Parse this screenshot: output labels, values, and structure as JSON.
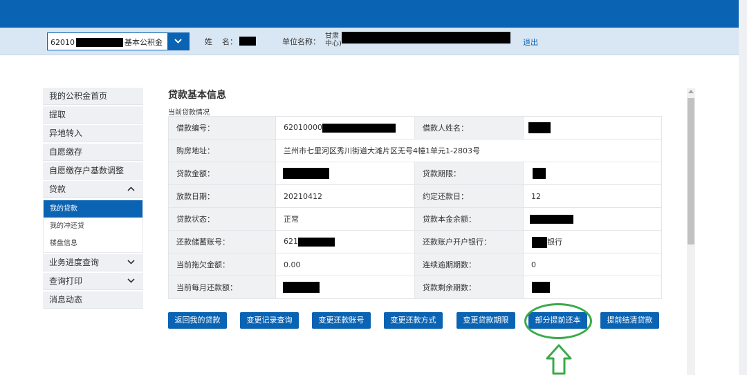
{
  "header": {
    "account_prefix": "62010",
    "account_type": "基本公积金",
    "name_label": "姓    名：",
    "unit_label": "单位名称：",
    "unit_visible": "甘肃 中心)",
    "logout": "退出"
  },
  "sidebar": {
    "items": [
      {
        "label": "我的公积金首页"
      },
      {
        "label": "提取"
      },
      {
        "label": "异地转入"
      },
      {
        "label": "自愿缴存"
      },
      {
        "label": "自愿缴存户基数调整"
      },
      {
        "label": "贷款",
        "expanded": true
      },
      {
        "label": "业务进度查询"
      },
      {
        "label": "查询打印"
      },
      {
        "label": "消息动态"
      }
    ],
    "sub_items": [
      {
        "label": "我的贷款",
        "active": true
      },
      {
        "label": "我的冲还贷"
      },
      {
        "label": "楼盘信息"
      }
    ]
  },
  "main": {
    "title": "贷款基本信息",
    "subtitle": "当前贷款情况",
    "rows": [
      {
        "k1": "借款编号：",
        "v1": "62010000",
        "k2": "借款人姓名：",
        "v2": ""
      },
      {
        "k1": "购房地址：",
        "v1": "兰州市七里河区秀川街道大滩片区无号4幢1单元1-2803号"
      },
      {
        "k1": "贷款金额：",
        "v1": "",
        "k2": "贷款期限：",
        "v2": ""
      },
      {
        "k1": "放款日期：",
        "v1": "20210412",
        "k2": "约定还款日：",
        "v2": "12"
      },
      {
        "k1": "贷款状态：",
        "v1": "正常",
        "k2": "贷款本金余额：",
        "v2": ""
      },
      {
        "k1": "还款储蓄账号：",
        "v1": "621",
        "k2": "还款账户开户银行：",
        "v2": "银行"
      },
      {
        "k1": "当前拖欠金额：",
        "v1": "0.00",
        "k2": "连续逾期期数：",
        "v2": "0"
      },
      {
        "k1": "当前每月还款额：",
        "v1": "",
        "k2": "贷款剩余期数：",
        "v2": ""
      }
    ]
  },
  "actions": [
    {
      "label": "返回我的贷款"
    },
    {
      "label": "变更记录查询"
    },
    {
      "label": "变更还款账号"
    },
    {
      "label": "变更还款方式"
    },
    {
      "label": "变更贷款期限"
    },
    {
      "label": "部分提前还本",
      "highlighted": true
    },
    {
      "label": "提前结清贷款"
    }
  ],
  "colors": {
    "brand_blue": "#0a63b3",
    "highlight_green": "#3aaa4a"
  }
}
